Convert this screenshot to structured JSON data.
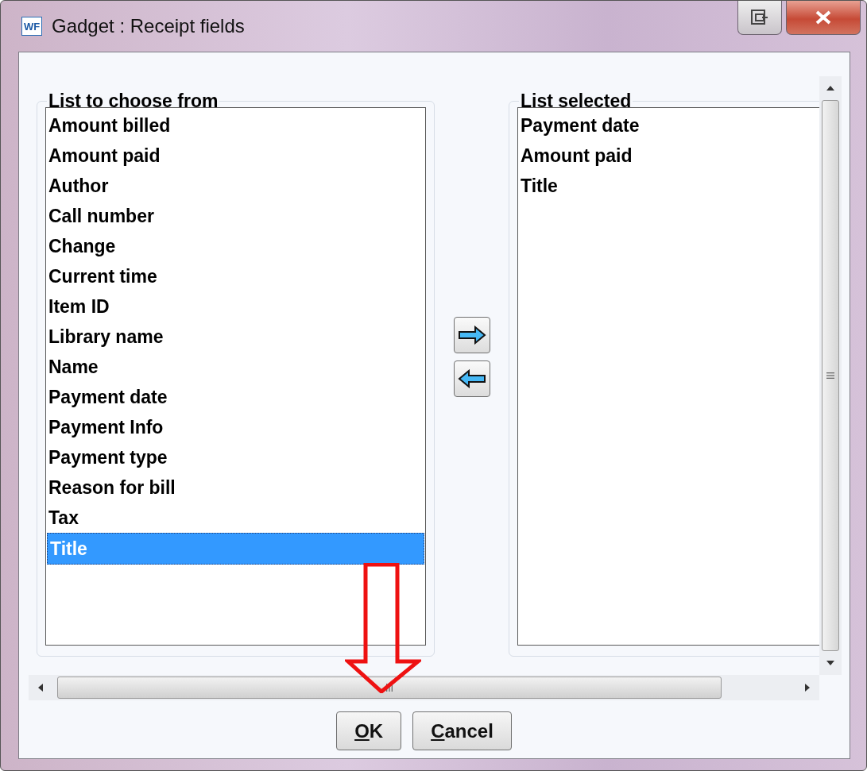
{
  "window": {
    "title": "Gadget : Receipt fields",
    "icon_text": "WF"
  },
  "available": {
    "label": "List to choose from",
    "items": [
      {
        "label": "Amount billed",
        "selected": false
      },
      {
        "label": "Amount paid",
        "selected": false
      },
      {
        "label": "Author",
        "selected": false
      },
      {
        "label": "Call number",
        "selected": false
      },
      {
        "label": "Change",
        "selected": false
      },
      {
        "label": "Current time",
        "selected": false
      },
      {
        "label": "Item ID",
        "selected": false
      },
      {
        "label": "Library name",
        "selected": false
      },
      {
        "label": "Name",
        "selected": false
      },
      {
        "label": "Payment date",
        "selected": false
      },
      {
        "label": "Payment Info",
        "selected": false
      },
      {
        "label": "Payment type",
        "selected": false
      },
      {
        "label": "Reason for bill",
        "selected": false
      },
      {
        "label": "Tax",
        "selected": false
      },
      {
        "label": "Title",
        "selected": true
      }
    ]
  },
  "chosen": {
    "label": "List selected",
    "items": [
      {
        "label": "Payment date",
        "selected": false
      },
      {
        "label": "Amount paid",
        "selected": false
      },
      {
        "label": "Title",
        "selected": false
      }
    ]
  },
  "buttons": [
    {
      "label": "OK",
      "underline_first": true
    },
    {
      "label": "Cancel",
      "underline_first": true
    }
  ]
}
